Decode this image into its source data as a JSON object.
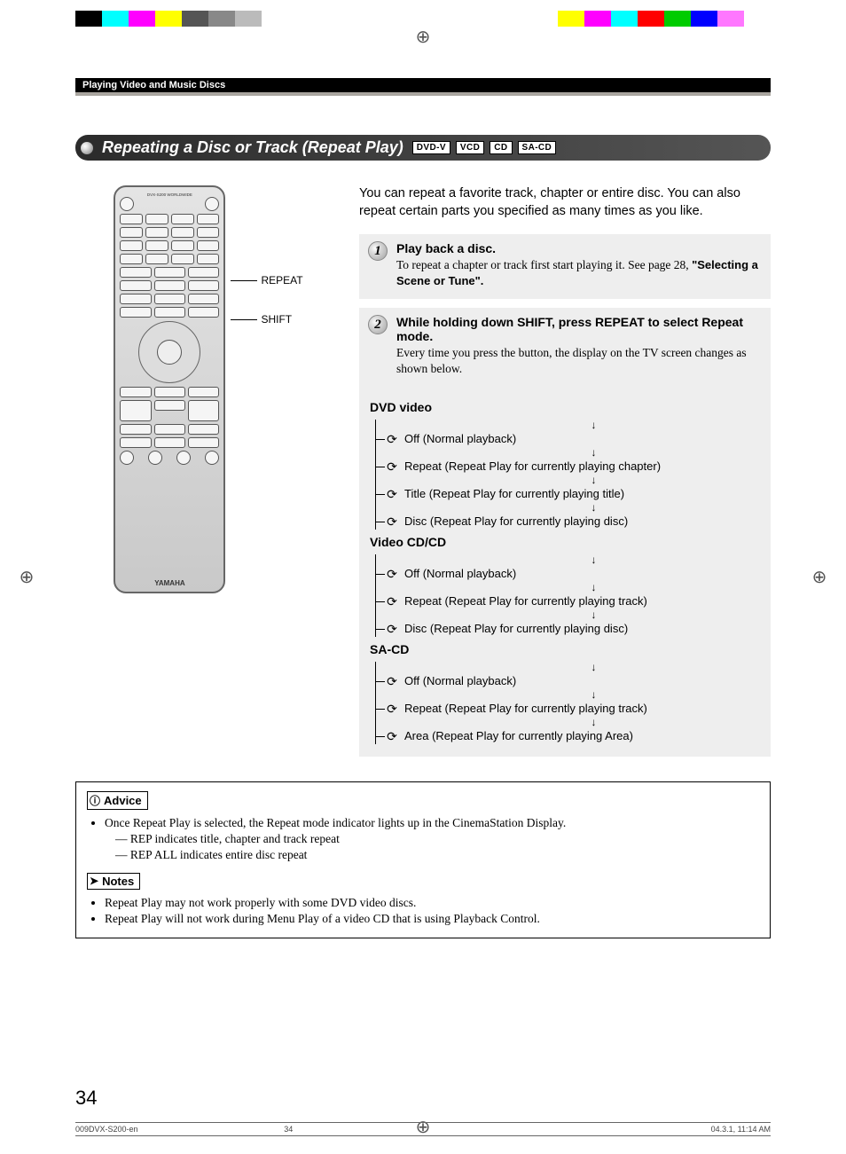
{
  "breadcrumb": "Playing Video and Music Discs",
  "title": "Repeating a Disc or Track (Repeat Play)",
  "media_tags": [
    "DVD-V",
    "VCD",
    "CD",
    "SA-CD"
  ],
  "remote": {
    "brand": "YAMAHA",
    "callouts": [
      "REPEAT",
      "SHIFT"
    ]
  },
  "intro": "You can repeat a favorite track, chapter or entire disc. You can also repeat certain parts you specified as many times as you like.",
  "steps": [
    {
      "num": "1",
      "head": "Play back a disc.",
      "body_pre": "To repeat a chapter or track first start playing it. See page 28, ",
      "body_bold": "\"Selecting a Scene or Tune\"."
    },
    {
      "num": "2",
      "head": "While holding down SHIFT, press REPEAT to select Repeat mode.",
      "body_pre": "Every time you press the button, the display on the TV screen changes as shown below.",
      "body_bold": ""
    }
  ],
  "flows": [
    {
      "title": "DVD video",
      "items": [
        "Off (Normal playback)",
        "Repeat (Repeat Play for currently playing chapter)",
        "Title (Repeat Play for currently playing title)",
        "Disc (Repeat Play for currently playing disc)"
      ]
    },
    {
      "title": "Video CD/CD",
      "items": [
        "Off (Normal playback)",
        "Repeat (Repeat Play for currently playing track)",
        "Disc (Repeat Play for currently playing disc)"
      ]
    },
    {
      "title": "SA-CD",
      "items": [
        "Off (Normal playback)",
        "Repeat (Repeat Play for currently playing track)",
        "Area (Repeat Play for currently playing Area)"
      ]
    }
  ],
  "advice": {
    "label": "Advice",
    "main": "Once Repeat Play is selected, the Repeat mode indicator lights up in the CinemaStation Display.",
    "sub": [
      "REP indicates title, chapter and track repeat",
      "REP ALL indicates entire disc repeat"
    ]
  },
  "notes": {
    "label": "Notes",
    "items": [
      "Repeat Play may not work properly with some DVD video discs.",
      "Repeat Play will not work during Menu Play of a video CD that is using Playback Control."
    ]
  },
  "page_number": "34",
  "footer": {
    "file": "009DVX-S200-en",
    "page": "34",
    "date": "04.3.1, 11:14 AM"
  },
  "registration_colors_left": [
    "#000",
    "#0ff",
    "#f0f",
    "#ff0",
    "#555",
    "#888",
    "#bbb",
    "#fff"
  ],
  "registration_colors_right": [
    "#ff0",
    "#f0f",
    "#0ff",
    "#f00",
    "#0c0",
    "#00f",
    "#f7f",
    "#fff"
  ]
}
